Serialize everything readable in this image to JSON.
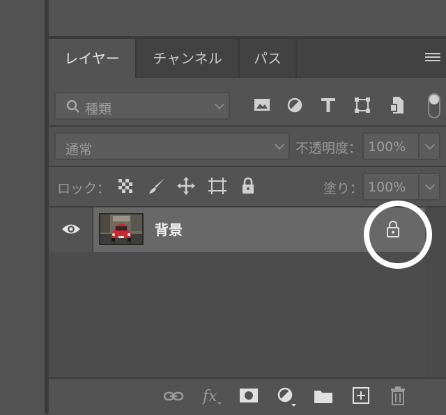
{
  "tabs": [
    {
      "label": "レイヤー",
      "active": true
    },
    {
      "label": "チャンネル",
      "active": false
    },
    {
      "label": "パス",
      "active": false
    }
  ],
  "filter": {
    "kind_label": "種類"
  },
  "blend": {
    "mode_label": "通常",
    "opacity_label": "不透明度：",
    "opacity_value": "100%"
  },
  "lock": {
    "label": "ロック：",
    "fill_label": "塗り：",
    "fill_value": "100%"
  },
  "layers": [
    {
      "name": "背景",
      "visible": true,
      "locked": true
    }
  ],
  "colors": {
    "panel_bg": "#535353",
    "tab_bar": "#424242",
    "layer_row": "#686868",
    "highlight_circle": "#ffffff"
  }
}
